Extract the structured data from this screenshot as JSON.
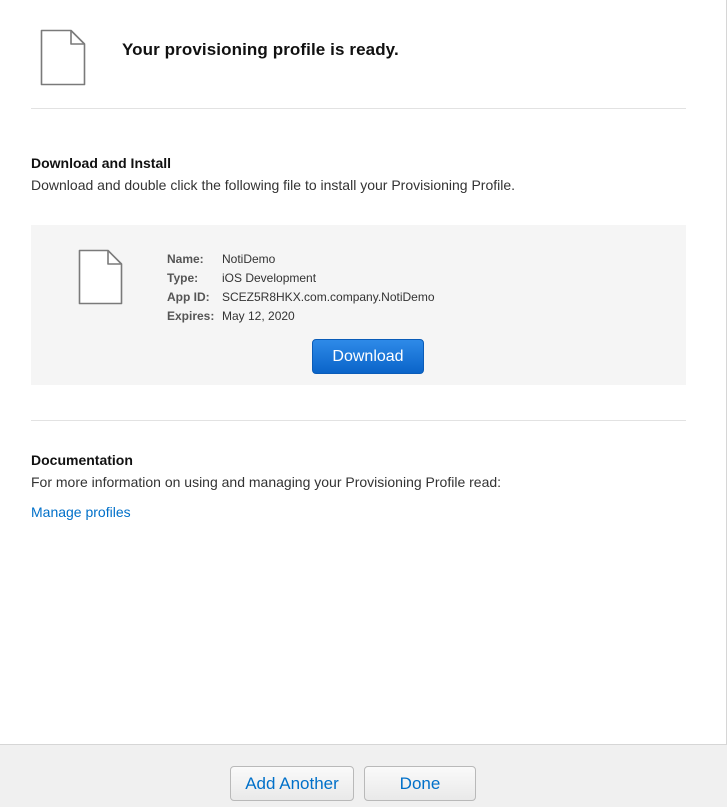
{
  "header": {
    "title": "Your provisioning profile is ready.",
    "icon": "document-icon"
  },
  "install": {
    "title": "Download and Install",
    "text": "Download and double click the following file to install your Provisioning Profile."
  },
  "profile": {
    "icon": "document-icon",
    "details": [
      {
        "label": "Name:",
        "value": "NotiDemo"
      },
      {
        "label": "Type:",
        "value": "iOS Development"
      },
      {
        "label": "App ID:",
        "value": "SCEZ5R8HKX.com.company.NotiDemo"
      },
      {
        "label": "Expires:",
        "value": "May 12, 2020"
      }
    ],
    "download_label": "Download"
  },
  "documentation": {
    "title": "Documentation",
    "text": "For more information on using and managing your Provisioning Profile read:",
    "link_label": "Manage profiles"
  },
  "footer": {
    "add_another_label": "Add Another",
    "done_label": "Done"
  },
  "colors": {
    "accent": "#0070c9",
    "button_primary": "#1a7ad9"
  }
}
